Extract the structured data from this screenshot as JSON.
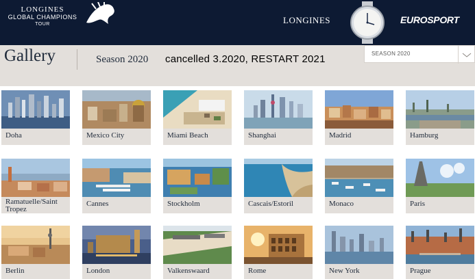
{
  "header": {
    "brand_line1": "LONGINES",
    "brand_line2": "GLOBAL CHAMPIONS",
    "brand_line3": "TOUR",
    "sponsor": "LONGINES",
    "broadcaster": "EUROSPORT"
  },
  "titlebar": {
    "title": "Gallery",
    "season": "Season 2020",
    "note": "cancelled 3.2020,  RESTART  2021",
    "select_value": "SEASON 2020",
    "chevron_icon": "chevron-down-icon"
  },
  "gallery": [
    {
      "label": "Doha"
    },
    {
      "label": "Mexico City"
    },
    {
      "label": "Miami Beach"
    },
    {
      "label": "Shanghai"
    },
    {
      "label": "Madrid"
    },
    {
      "label": "Hamburg"
    },
    {
      "label": "Ramatuelle/Saint Tropez"
    },
    {
      "label": "Cannes"
    },
    {
      "label": "Stockholm"
    },
    {
      "label": "Cascais/Estoril"
    },
    {
      "label": "Monaco"
    },
    {
      "label": "Paris"
    },
    {
      "label": "Berlin"
    },
    {
      "label": "London"
    },
    {
      "label": "Valkenswaard"
    },
    {
      "label": "Rome"
    },
    {
      "label": "New York"
    },
    {
      "label": "Prague"
    }
  ],
  "colors": {
    "header_bg": "#0d1a33",
    "caption_bg": "#e3dfdb",
    "text": "#1f2a3a"
  }
}
